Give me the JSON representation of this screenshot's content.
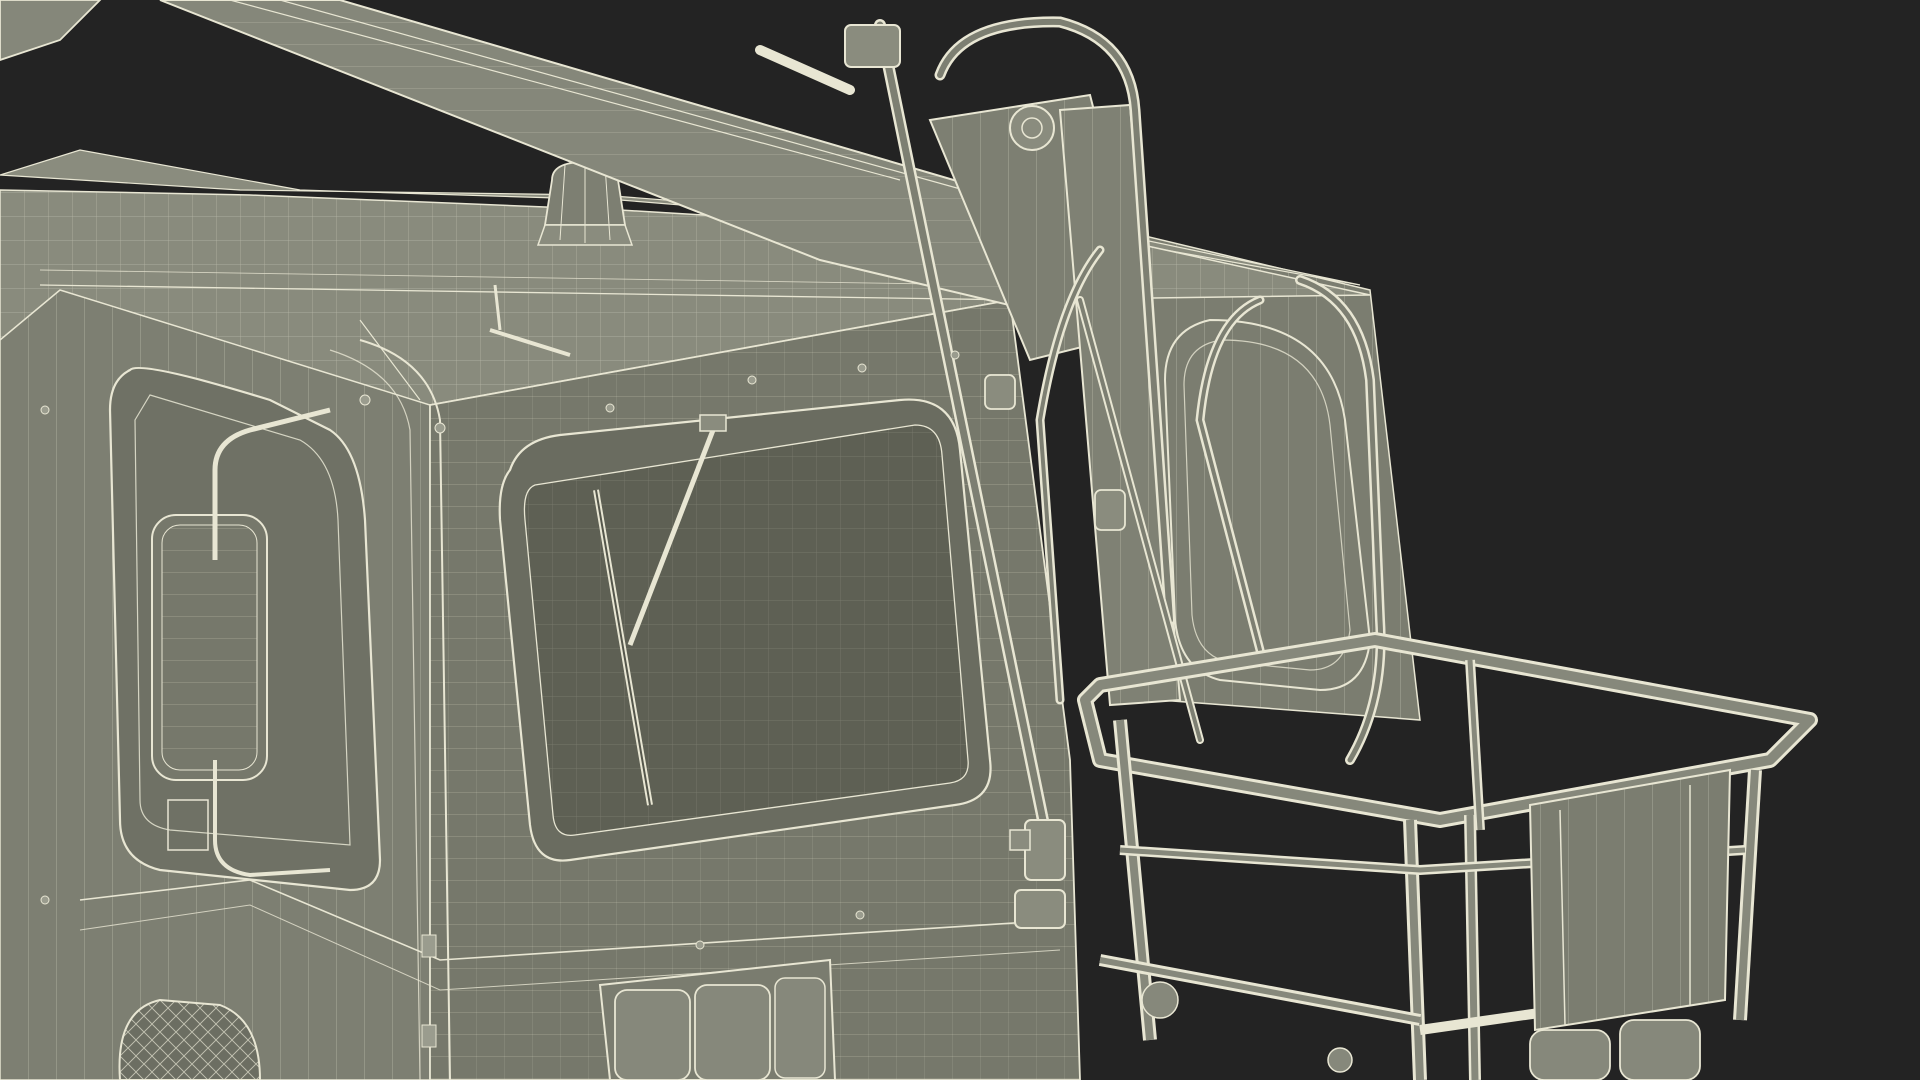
{
  "scene": {
    "subject": "wireframe-3d-model",
    "style": "wireframe-over-shaded",
    "colors": {
      "background": "#232323",
      "body_fill": "#7f8173",
      "body_fill_dark": "#6b6d60",
      "body_fill_light": "#8f9183",
      "glass_fill": "#5c5e52",
      "wire": "#e8e6d3",
      "wire_dim": "#cfcdb9"
    },
    "parts": [
      "cab-body",
      "roof",
      "boom-arm",
      "beacon",
      "windshield",
      "wiper",
      "side-window",
      "side-mirror",
      "hydraulic-hoses",
      "rear-panel",
      "work-basket",
      "control-box",
      "tail-light",
      "wheel"
    ]
  }
}
